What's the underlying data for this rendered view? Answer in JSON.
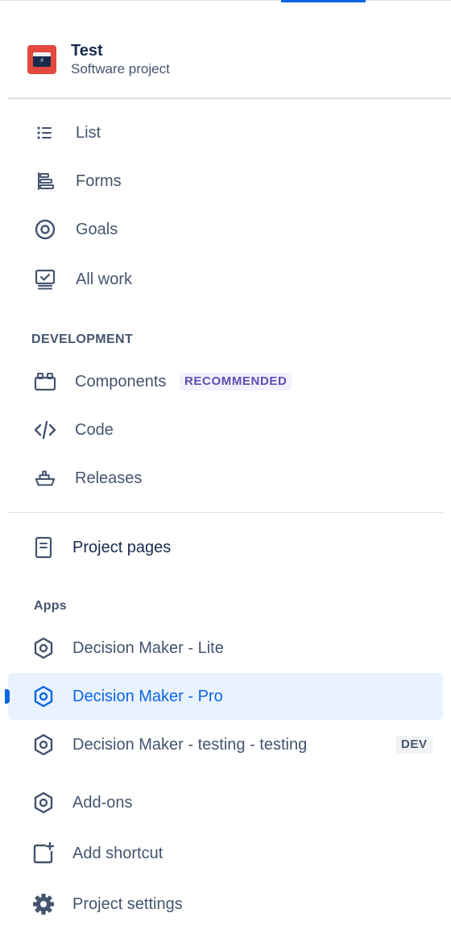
{
  "project": {
    "name": "Test",
    "type": "Software project"
  },
  "nav_top": [
    {
      "label": "List",
      "icon": "list-icon"
    },
    {
      "label": "Forms",
      "icon": "forms-icon"
    },
    {
      "label": "Goals",
      "icon": "goals-icon"
    },
    {
      "label": "All work",
      "icon": "all-work-icon"
    }
  ],
  "development": {
    "heading": "DEVELOPMENT",
    "items": [
      {
        "label": "Components",
        "icon": "components-icon",
        "badge": "RECOMMENDED"
      },
      {
        "label": "Code",
        "icon": "code-icon"
      },
      {
        "label": "Releases",
        "icon": "releases-icon"
      }
    ]
  },
  "project_pages": {
    "label": "Project pages",
    "icon": "page-icon"
  },
  "apps": {
    "heading": "Apps",
    "items": [
      {
        "label": "Decision Maker - Lite",
        "icon": "app-hexagon-icon"
      },
      {
        "label": "Decision Maker - Pro",
        "icon": "app-hexagon-icon",
        "selected": true
      },
      {
        "label": "Decision Maker - testing - testing",
        "icon": "app-hexagon-icon",
        "badge": "DEV"
      }
    ]
  },
  "footer_items": [
    {
      "label": "Add-ons",
      "icon": "app-hexagon-icon"
    },
    {
      "label": "Add shortcut",
      "icon": "add-shortcut-icon"
    },
    {
      "label": "Project settings",
      "icon": "gear-icon"
    }
  ],
  "colors": {
    "accent": "#0C66E4",
    "selected_bg": "#E9F2FF",
    "text": "#44546F",
    "avatar": "#E2483D",
    "badge_purple_bg": "#F3F0FF",
    "badge_purple_text": "#5E4DB2"
  }
}
